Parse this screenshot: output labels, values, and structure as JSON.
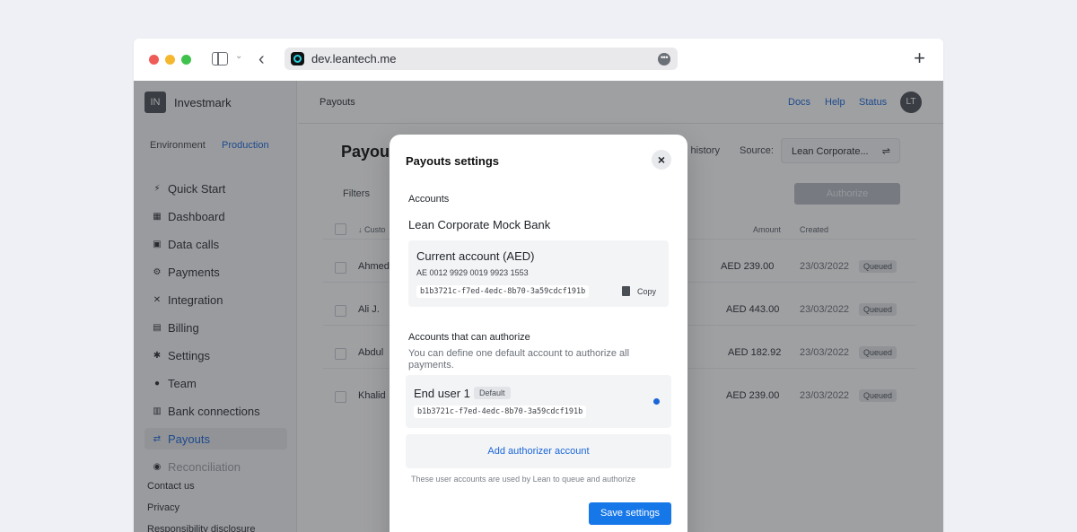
{
  "browser": {
    "url": "dev.leantech.me",
    "more_glyph": "•••",
    "new_tab_glyph": "+",
    "back_glyph": "‹",
    "toggle_chevron": "⌄"
  },
  "sidebar": {
    "org_initials": "IN",
    "org_name": "Investmark",
    "env_label": "Environment",
    "env_value": "Production",
    "items": [
      {
        "label": "Quick Start",
        "icon": "⚡"
      },
      {
        "label": "Dashboard",
        "icon": "▦"
      },
      {
        "label": "Data calls",
        "icon": "▣"
      },
      {
        "label": "Payments",
        "icon": "⚙"
      },
      {
        "label": "Integration",
        "icon": "✕"
      },
      {
        "label": "Billing",
        "icon": "▤"
      },
      {
        "label": "Settings",
        "icon": "✱"
      },
      {
        "label": "Team",
        "icon": "●"
      },
      {
        "label": "Bank connections",
        "icon": "▥"
      },
      {
        "label": "Payouts",
        "icon": "⇄"
      },
      {
        "label": "Reconciliation",
        "icon": "◉"
      }
    ],
    "footer": [
      "Contact us",
      "Privacy",
      "Responsibility disclosure"
    ]
  },
  "header": {
    "breadcrumb": "Payouts",
    "links": [
      "Docs",
      "Help",
      "Status"
    ],
    "user_initials": "LT"
  },
  "page": {
    "title": "Payou",
    "history_link": "s history",
    "source_label": "Source:",
    "source_value": "Lean Corporate...",
    "source_icon": "⇌",
    "filters": "Filters",
    "authorize": "Authorize",
    "columns": [
      "↓ Custo",
      "Amount",
      "Created"
    ],
    "rows": [
      {
        "customer": "Ahmed",
        "amount": "AED  239.00",
        "created": "23/03/2022",
        "status": "Queued"
      },
      {
        "customer": "Ali J.",
        "amount": "AED  443.00",
        "created": "23/03/2022",
        "status": "Queued"
      },
      {
        "customer": "Abdul",
        "amount": "AED  182.92",
        "created": "23/03/2022",
        "status": "Queued"
      },
      {
        "customer": "Khalid",
        "amount": "AED  239.00",
        "created": "23/03/2022",
        "status": "Queued"
      }
    ]
  },
  "modal": {
    "title": "Payouts settings",
    "close": "×",
    "accounts_label": "Accounts",
    "bank": "Lean Corporate Mock Bank",
    "account": {
      "name": "Current account (AED)",
      "iban": "AE 0012 9929 0019 9923 1553",
      "id": "b1b3721c-f7ed-4edc-8b70-3a59cdcf191b",
      "copy": "Copy"
    },
    "authorizers_label": "Accounts that can authorize",
    "authorizers_desc": "You can define one default account to authorize all payments.",
    "authorizer": {
      "name": "End user 1",
      "badge": "Default",
      "id": "b1b3721c-f7ed-4edc-8b70-3a59cdcf191b"
    },
    "add_button": "Add authorizer account",
    "footnote": "These user accounts are used by Lean to queue and authorize",
    "save_button": "Save settings"
  }
}
